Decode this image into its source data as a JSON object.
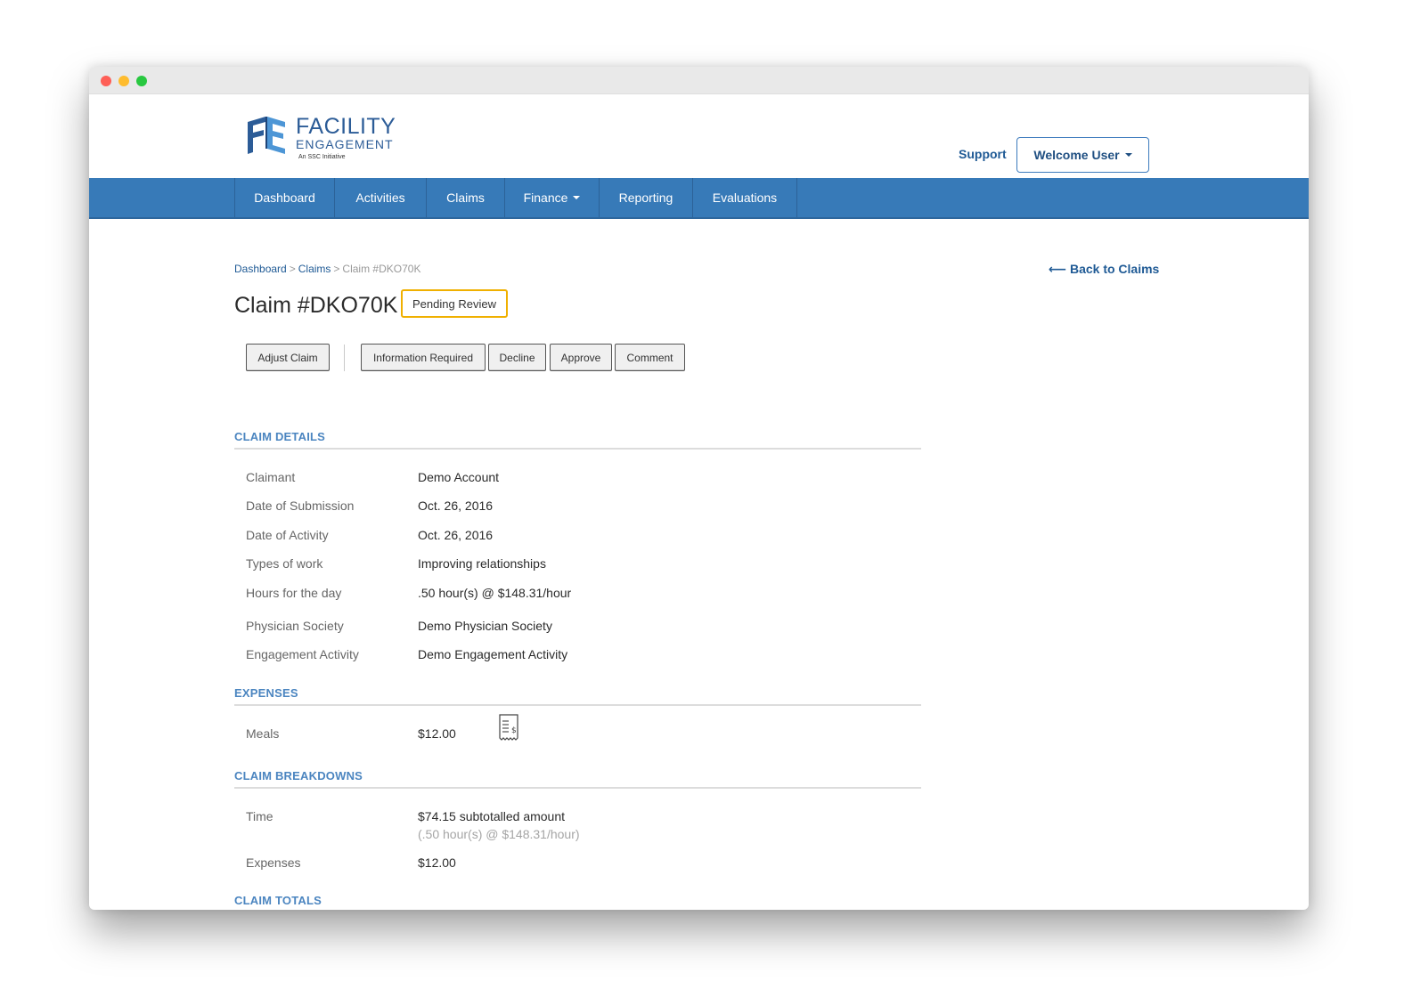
{
  "header": {
    "logo": {
      "word1": "FACILITY",
      "word2": "ENGAGEMENT",
      "tagline": "An SSC Initiative",
      "brand_color": "#2c5c97",
      "accent_color": "#4d96d6"
    },
    "support_label": "Support",
    "user_menu_label": "Welcome User"
  },
  "nav": {
    "items": [
      {
        "label": "Dashboard",
        "has_dropdown": false
      },
      {
        "label": "Activities",
        "has_dropdown": false
      },
      {
        "label": "Claims",
        "has_dropdown": false
      },
      {
        "label": "Finance",
        "has_dropdown": true
      },
      {
        "label": "Reporting",
        "has_dropdown": false
      },
      {
        "label": "Evaluations",
        "has_dropdown": false
      }
    ],
    "bar_color": "#377ab8"
  },
  "breadcrumb": {
    "items": [
      "Dashboard",
      "Claims"
    ],
    "current": "Claim #DKO70K"
  },
  "back_link": "⟵ Back to Claims",
  "page": {
    "title": "Claim #DKO70K",
    "status": "Pending Review",
    "status_color": "#f0b000"
  },
  "actions": {
    "adjust": "Adjust Claim",
    "information_required": "Information Required",
    "decline": "Decline",
    "approve": "Approve",
    "comment": "Comment"
  },
  "claim_details": {
    "heading": "CLAIM DETAILS",
    "rows": [
      {
        "label": "Claimant",
        "value": "Demo Account"
      },
      {
        "label": "Date of Submission",
        "value": "Oct. 26, 2016"
      },
      {
        "label": "Date of Activity",
        "value": "Oct. 26, 2016"
      },
      {
        "label": "Types of work",
        "value": "Improving relationships"
      },
      {
        "label": "Hours for the day",
        "value": ".50 hour(s) @ $148.31/hour"
      },
      {
        "label": "Physician Society",
        "value": "Demo Physician Society"
      },
      {
        "label": "Engagement Activity",
        "value": "Demo Engagement Activity"
      }
    ]
  },
  "expenses": {
    "heading": "EXPENSES",
    "rows": [
      {
        "label": "Meals",
        "value": "$12.00",
        "icon": "receipt-icon"
      }
    ]
  },
  "claim_breakdowns": {
    "heading": "CLAIM BREAKDOWNS",
    "rows": [
      {
        "label": "Time",
        "value": "$74.15 subtotalled amount",
        "subvalue": "(.50 hour(s) @ $148.31/hour)"
      },
      {
        "label": "Expenses",
        "value": "$12.00"
      }
    ]
  },
  "claim_totals": {
    "heading": "CLAIM TOTALS"
  }
}
